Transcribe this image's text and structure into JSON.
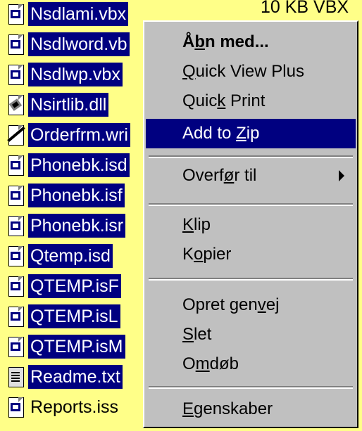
{
  "files": [
    {
      "name": "Nsdlami.vbx",
      "icon": "vbx-file-icon",
      "selected": true
    },
    {
      "name": "Nsdlword.vb",
      "icon": "vbx-file-icon",
      "selected": true
    },
    {
      "name": "Nsdlwp.vbx",
      "icon": "vbx-file-icon",
      "selected": true
    },
    {
      "name": "Nsirtlib.dll",
      "icon": "dll-file-icon",
      "selected": true
    },
    {
      "name": "Orderfrm.wri",
      "icon": "write-document-icon",
      "selected": true
    },
    {
      "name": "Phonebk.isd",
      "icon": "isd-file-icon",
      "selected": true
    },
    {
      "name": "Phonebk.isf",
      "icon": "isf-file-icon",
      "selected": true
    },
    {
      "name": "Phonebk.isr",
      "icon": "isr-file-icon",
      "selected": true
    },
    {
      "name": "Qtemp.isd",
      "icon": "isd-file-icon",
      "selected": true
    },
    {
      "name": "QTEMP.isF",
      "icon": "isf-file-icon",
      "selected": true
    },
    {
      "name": "QTEMP.isL",
      "icon": "isl-file-icon",
      "selected": true
    },
    {
      "name": "QTEMP.isM",
      "icon": "ism-file-icon",
      "selected": true
    },
    {
      "name": "Readme.txt",
      "icon": "text-file-icon",
      "selected": true
    },
    {
      "name": "Reports.iss",
      "icon": "iss-file-icon",
      "selected": false
    }
  ],
  "size_column_text": "10 KB   VBX",
  "context_menu": {
    "open_with": {
      "pre": "Å",
      "acc": "b",
      "post": "n med..."
    },
    "quick_view": {
      "pre": "",
      "acc": "Q",
      "post": "uick View Plus"
    },
    "quick_print": {
      "pre": "Quic",
      "acc": "k",
      "post": " Print"
    },
    "add_to_zip": {
      "pre": "Add to ",
      "acc": "Z",
      "post": "ip"
    },
    "send_to": {
      "pre": "Overf",
      "acc": "ø",
      "post": "r til"
    },
    "cut": {
      "pre": "",
      "acc": "K",
      "post": "lip"
    },
    "copy": {
      "pre": "K",
      "acc": "o",
      "post": "pier"
    },
    "create_shortcut": {
      "pre": "Opret gen",
      "acc": "v",
      "post": "ej"
    },
    "delete": {
      "pre": "",
      "acc": "S",
      "post": "let"
    },
    "rename": {
      "pre": "O",
      "acc": "m",
      "post": "døb"
    },
    "properties": {
      "pre": "",
      "acc": "E",
      "post": "genskaber"
    }
  },
  "colors": {
    "selection": "#000080",
    "menu_bg": "#c0c0c0",
    "background": "#ffff88"
  }
}
